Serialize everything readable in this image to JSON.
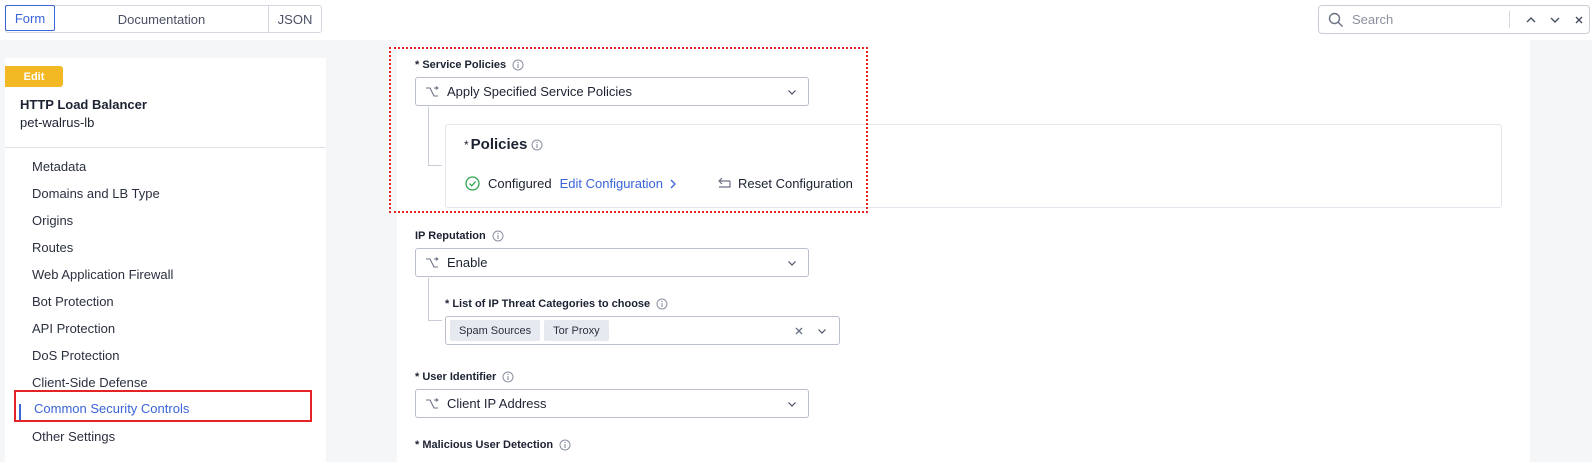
{
  "tabs": [
    {
      "label": "Form",
      "active": true
    },
    {
      "label": "Documentation",
      "active": false
    },
    {
      "label": "JSON",
      "active": false
    }
  ],
  "search": {
    "placeholder": "Search"
  },
  "sidebar": {
    "badge": "Edit",
    "object_type": "HTTP Load Balancer",
    "object_name": "pet-walrus-lb",
    "items": [
      {
        "label": "Metadata"
      },
      {
        "label": "Domains and LB Type"
      },
      {
        "label": "Origins"
      },
      {
        "label": "Routes"
      },
      {
        "label": "Web Application Firewall"
      },
      {
        "label": "Bot Protection"
      },
      {
        "label": "API Protection"
      },
      {
        "label": "DoS Protection"
      },
      {
        "label": "Client-Side Defense"
      },
      {
        "label": "Common Security Controls",
        "active": true
      },
      {
        "label": "Other Settings"
      }
    ]
  },
  "form": {
    "service_policies": {
      "label": "* Service Policies",
      "value": "Apply Specified Service Policies"
    },
    "policies": {
      "star": "*",
      "title": "Policies",
      "status": "Configured",
      "edit_label": "Edit Configuration",
      "reset_label": "Reset Configuration"
    },
    "ip_reputation": {
      "label": "IP Reputation",
      "value": "Enable"
    },
    "ip_threat_categories": {
      "label": "* List of IP Threat Categories to choose",
      "chips": [
        "Spam Sources",
        "Tor Proxy"
      ]
    },
    "user_identifier": {
      "label": "* User Identifier",
      "value": "Client IP Address"
    },
    "malicious_user_detection": {
      "label": "* Malicious User Detection"
    }
  },
  "colors": {
    "accent": "#3a64d8",
    "badge": "#f2b924",
    "highlight": "#e42424",
    "success": "#2ea44f"
  }
}
